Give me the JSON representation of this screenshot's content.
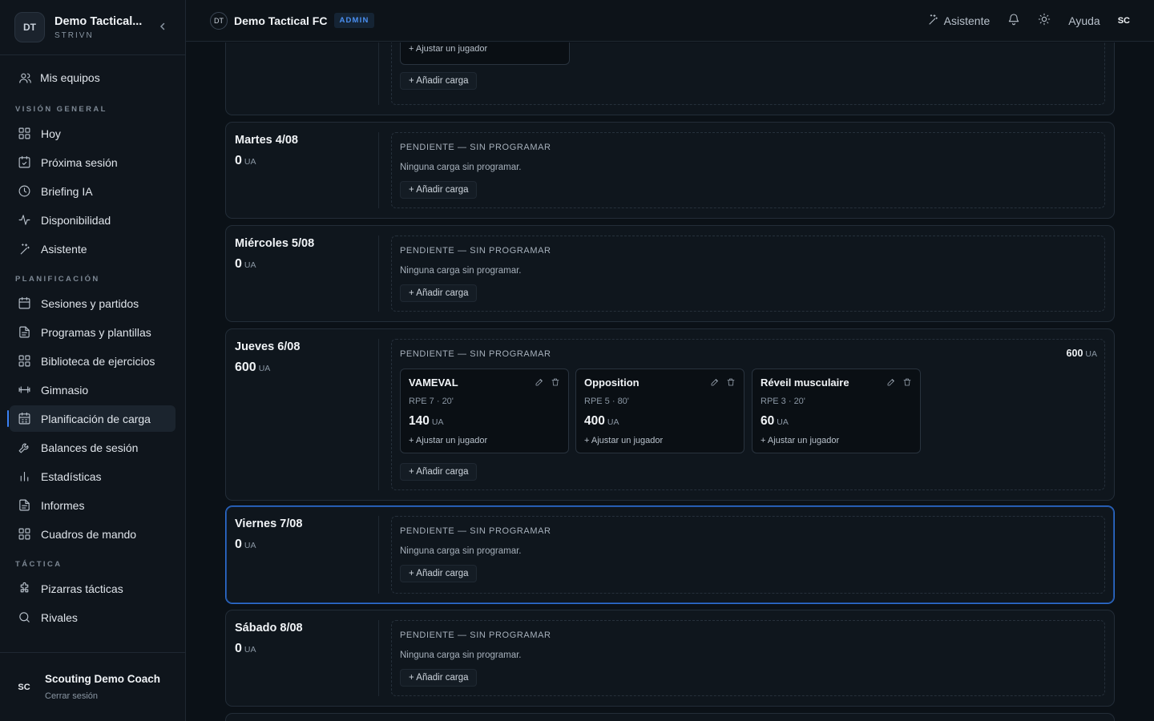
{
  "brand": {
    "badge": "DT",
    "name": "Demo Tactical...",
    "sub": "STRIVN",
    "collapse": "‹"
  },
  "sidebar": {
    "my_teams": "Mis equipos",
    "sections": [
      {
        "label": "VISIÓN GENERAL",
        "items": [
          "Hoy",
          "Próxima sesión",
          "Briefing IA",
          "Disponibilidad",
          "Asistente"
        ]
      },
      {
        "label": "PLANIFICACIÓN",
        "items": [
          "Sesiones y partidos",
          "Programas y plantillas",
          "Biblioteca de ejercicios",
          "Gimnasio",
          "Planificación de carga",
          "Balances de sesión",
          "Estadísticas",
          "Informes",
          "Cuadros de mando"
        ]
      },
      {
        "label": "TÁCTICA",
        "items": [
          "Pizarras tácticas",
          "Rivales"
        ]
      }
    ],
    "active_item": "Planificación de carga"
  },
  "user": {
    "initials": "SC",
    "name": "Scouting Demo Coach",
    "logout": "Cerrar sesión"
  },
  "topbar": {
    "team_initials": "DT",
    "team_name": "Demo Tactical FC",
    "role_badge": "ADMIN",
    "assistant": "Asistente",
    "help": "Ayuda",
    "user_initials": "SC"
  },
  "labels": {
    "pending": "PENDIENTE — SIN PROGRAMAR",
    "empty": "Ninguna carga sin programar.",
    "add_load": "+ Añadir carga",
    "adjust_player": "+ Ajustar un jugador",
    "unit": "UA"
  },
  "days": [
    {
      "name": "Martes 4/08",
      "load": "0"
    },
    {
      "name": "Miércoles 5/08",
      "load": "0"
    },
    {
      "name": "Jueves 6/08",
      "load": "600",
      "total": "600"
    },
    {
      "name": "Viernes 7/08",
      "load": "0"
    },
    {
      "name": "Sábado 8/08",
      "load": "0"
    }
  ],
  "sessions": [
    {
      "title": "VAMEVAL",
      "meta": "RPE 7 · 20'",
      "load": "140"
    },
    {
      "title": "Opposition",
      "meta": "RPE 5 · 80'",
      "load": "400"
    },
    {
      "title": "Réveil musculaire",
      "meta": "RPE 3 · 20'",
      "load": "60"
    }
  ],
  "colors": {
    "accent": "#3b82f6",
    "background": "#0b1117",
    "card": "#0f161d"
  }
}
